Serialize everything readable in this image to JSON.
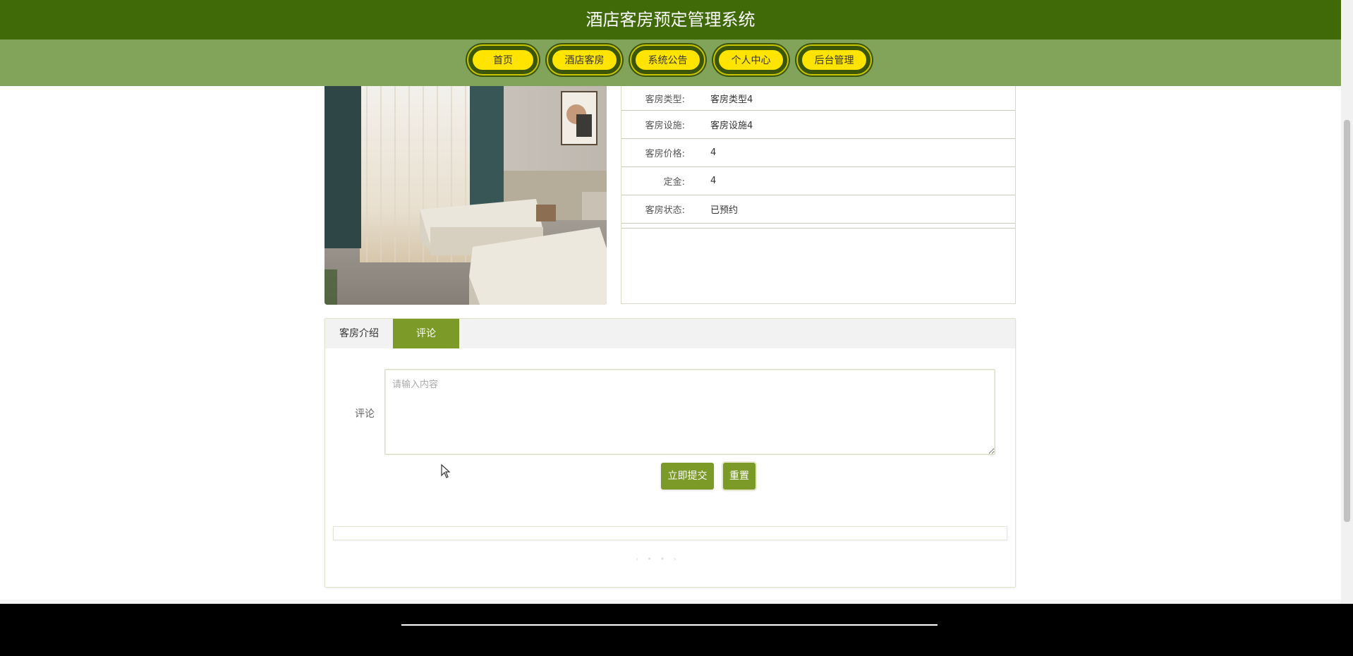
{
  "header": {
    "title": "酒店客房预定管理系统"
  },
  "nav": {
    "items": [
      {
        "label": "首页"
      },
      {
        "label": "酒店客房"
      },
      {
        "label": "系统公告"
      },
      {
        "label": "个人中心"
      },
      {
        "label": "后台管理"
      }
    ]
  },
  "room": {
    "fields": [
      {
        "label": "客房类型:",
        "value": "客房类型4"
      },
      {
        "label": "客房设施:",
        "value": "客房设施4"
      },
      {
        "label": "客房价格:",
        "value": "4"
      },
      {
        "label": "定金:",
        "value": "4"
      },
      {
        "label": "客房状态:",
        "value": "已预约"
      }
    ]
  },
  "tabs": {
    "items": [
      {
        "label": "客房介绍"
      },
      {
        "label": "评论"
      }
    ],
    "active": "评论"
  },
  "comment": {
    "label": "评论",
    "placeholder": "请输入内容",
    "submit_label": "立即提交",
    "reset_label": "重置"
  },
  "colors": {
    "title_bar": "#3f6a07",
    "nav_bar": "#82a35a",
    "nav_button": "#ffe400",
    "accent": "#7b9a28",
    "footer": "#000000"
  }
}
